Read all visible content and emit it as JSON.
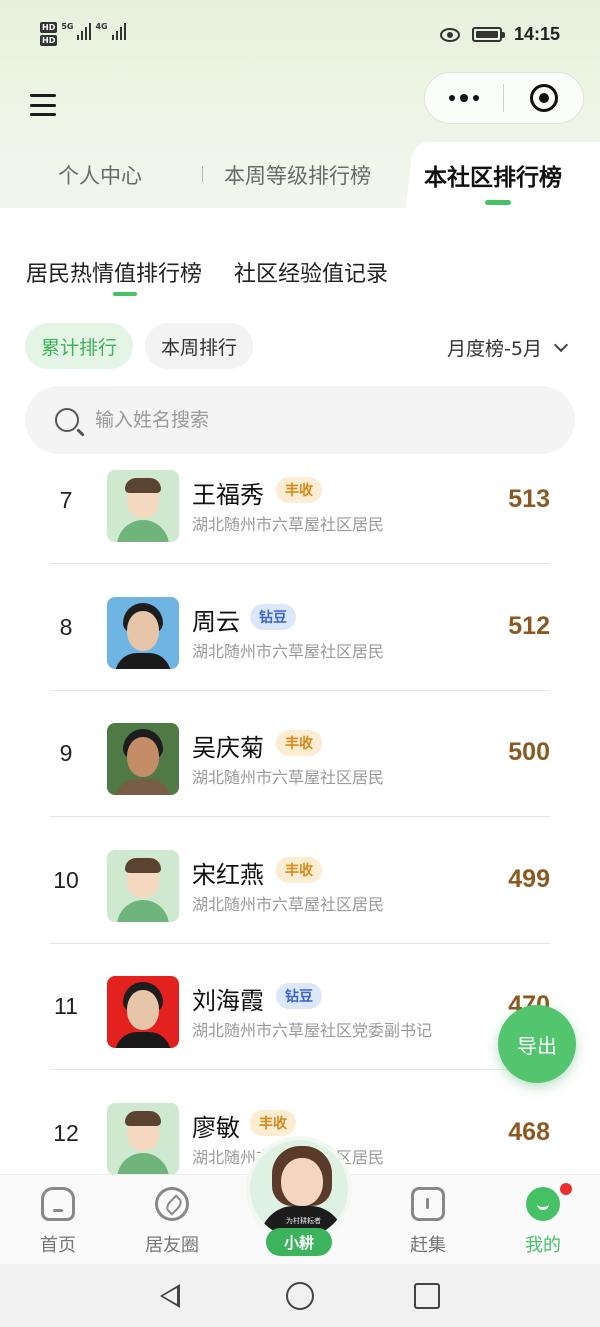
{
  "status_bar": {
    "time": "14:15",
    "hd1": "HD",
    "hd2": "HD",
    "net1": "5G",
    "net2": "4G"
  },
  "top_tabs": {
    "personal_center": "个人中心",
    "weekly_level_rank": "本周等级排行榜",
    "community_rank": "本社区排行榜"
  },
  "sub_tabs": {
    "enthusiasm_rank": "居民热情值排行榜",
    "experience_log": "社区经验值记录"
  },
  "filters": {
    "cumulative": "累计排行",
    "weekly": "本周排行",
    "month_selector": "月度榜-5月"
  },
  "search": {
    "placeholder": "输入姓名搜索"
  },
  "rankings": [
    {
      "rank": "7",
      "name": "王福秀",
      "badge": "丰收",
      "badge_type": "gold",
      "location": "湖北随州市六草屋社区居民",
      "score": "513",
      "avatar": "placeholder"
    },
    {
      "rank": "8",
      "name": "周云",
      "badge": "钻豆",
      "badge_type": "blue",
      "location": "湖北随州市六草屋社区居民",
      "score": "512",
      "avatar": "photo-blue"
    },
    {
      "rank": "9",
      "name": "吴庆菊",
      "badge": "丰收",
      "badge_type": "gold",
      "location": "湖北随州市六草屋社区居民",
      "score": "500",
      "avatar": "photo-green"
    },
    {
      "rank": "10",
      "name": "宋红燕",
      "badge": "丰收",
      "badge_type": "gold",
      "location": "湖北随州市六草屋社区居民",
      "score": "499",
      "avatar": "placeholder"
    },
    {
      "rank": "11",
      "name": "刘海霞",
      "badge": "钻豆",
      "badge_type": "blue",
      "location": "湖北随州市六草屋社区党委副书记",
      "score": "470",
      "avatar": "photo-red"
    },
    {
      "rank": "12",
      "name": "廖敏",
      "badge": "丰收",
      "badge_type": "gold",
      "location": "湖北随州市六草屋社区居民",
      "score": "468",
      "avatar": "placeholder"
    }
  ],
  "fab": {
    "export": "导出"
  },
  "bottom_nav": {
    "home": "首页",
    "friends_circle": "居友圈",
    "mascot": "小耕",
    "mascot_shirt": "为村耕耘者",
    "market": "赶集",
    "me": "我的"
  },
  "colors": {
    "accent": "#47c166",
    "score": "#8b5a22",
    "badge_gold": "#d68a1c",
    "badge_blue": "#3d67c7",
    "notification": "#e8312e"
  }
}
